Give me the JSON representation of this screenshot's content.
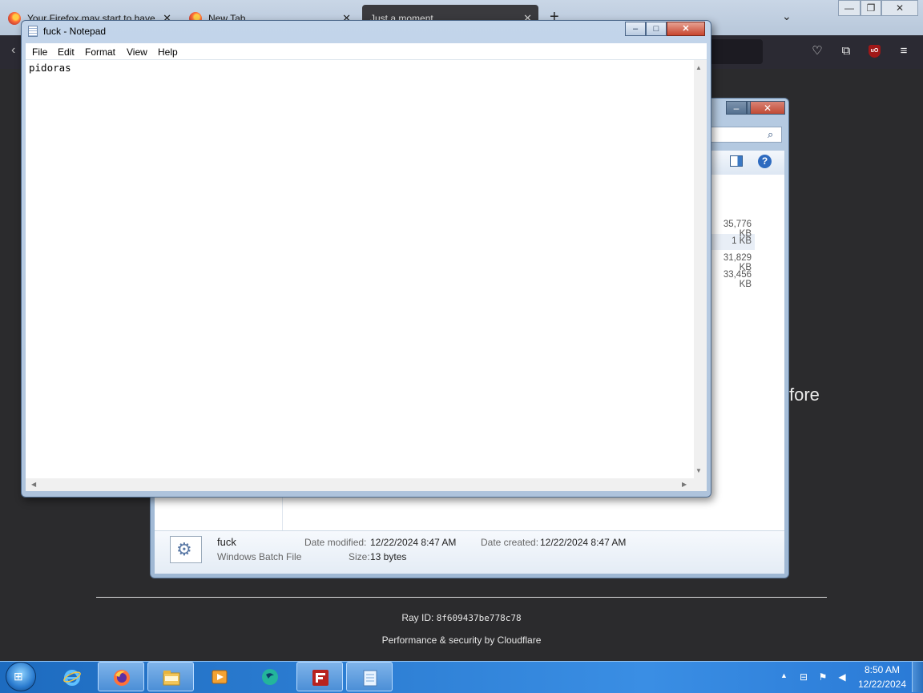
{
  "firefox": {
    "tabs": [
      {
        "label": "Your Firefox may start to have"
      },
      {
        "label": "New Tab"
      },
      {
        "label": "Just a moment..."
      }
    ],
    "new_tab_glyph": "+",
    "page": {
      "heading_fragment": "fore",
      "ray_label": "Ray ID:",
      "ray_id": "8f609437be778c78",
      "perf_prefix": "Performance & security by",
      "perf_brand": "Cloudflare"
    }
  },
  "explorer": {
    "sizes": [
      "35,776 KB",
      "1 KB",
      "31,829 KB",
      "33,456 KB"
    ],
    "details": {
      "file_name": "fuck",
      "file_type": "Windows Batch File",
      "date_modified_label": "Date modified:",
      "date_modified": "12/22/2024 8:47 AM",
      "date_created_label": "Date created:",
      "date_created": "12/22/2024 8:47 AM",
      "size_label": "Size:",
      "size": "13 bytes"
    }
  },
  "notepad": {
    "title": "fuck - Notepad",
    "menu": [
      "File",
      "Edit",
      "Format",
      "View",
      "Help"
    ],
    "content": "pidoras"
  },
  "taskbar": {
    "time": "8:50 AM",
    "date": "12/22/2024"
  }
}
